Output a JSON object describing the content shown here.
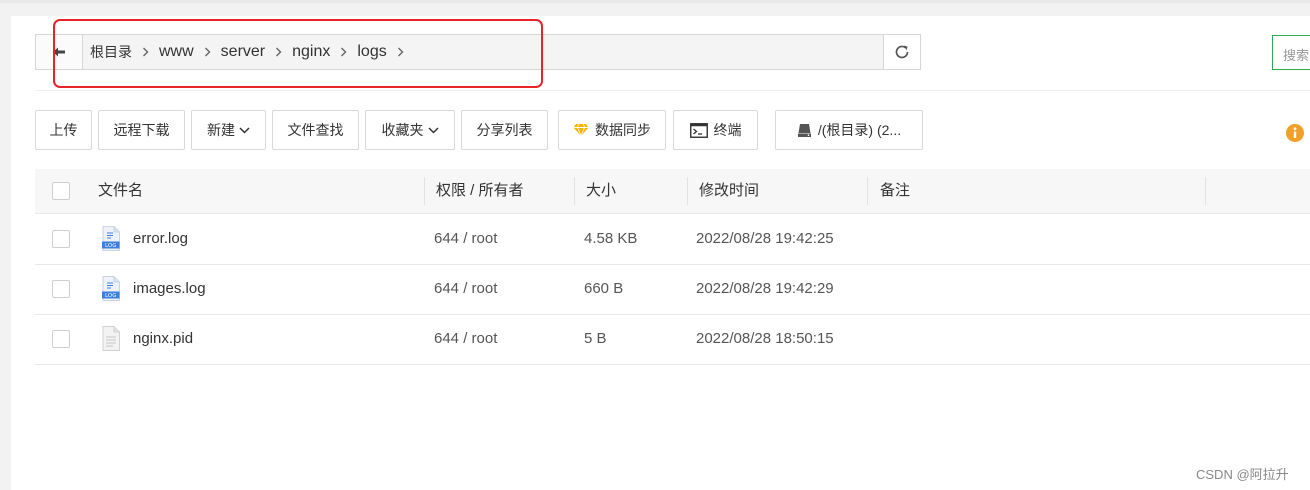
{
  "breadcrumb": {
    "root": "根目录",
    "items": [
      "www",
      "server",
      "nginx",
      "logs"
    ]
  },
  "search": {
    "placeholder": "搜索"
  },
  "toolbar": {
    "upload": "上传",
    "remote_download": "远程下载",
    "new": "新建",
    "file_search": "文件查找",
    "favorites": "收藏夹",
    "share_list": "分享列表",
    "data_sync": "数据同步",
    "terminal": "终端",
    "disk": "/(根目录) (2..."
  },
  "table": {
    "headers": {
      "name": "文件名",
      "perm": "权限 / 所有者",
      "size": "大小",
      "mtime": "修改时间",
      "note": "备注"
    },
    "rows": [
      {
        "name": "error.log",
        "perm": "644 / root",
        "size": "4.58 KB",
        "mtime": "2022/08/28 19:42:25",
        "icon": "log-file-icon"
      },
      {
        "name": "images.log",
        "perm": "644 / root",
        "size": "660 B",
        "mtime": "2022/08/28 19:42:29",
        "icon": "log-file-icon"
      },
      {
        "name": "nginx.pid",
        "perm": "644 / root",
        "size": "5 B",
        "mtime": "2022/08/28 18:50:15",
        "icon": "text-file-icon"
      }
    ]
  },
  "watermark": "CSDN @阿拉升",
  "colors": {
    "highlight_box": "#e8232a",
    "search_border": "#2fa84f",
    "info_icon": "#f0a02a",
    "sync_icon": "#f5b400",
    "log_icon": "#3c7fe0"
  }
}
